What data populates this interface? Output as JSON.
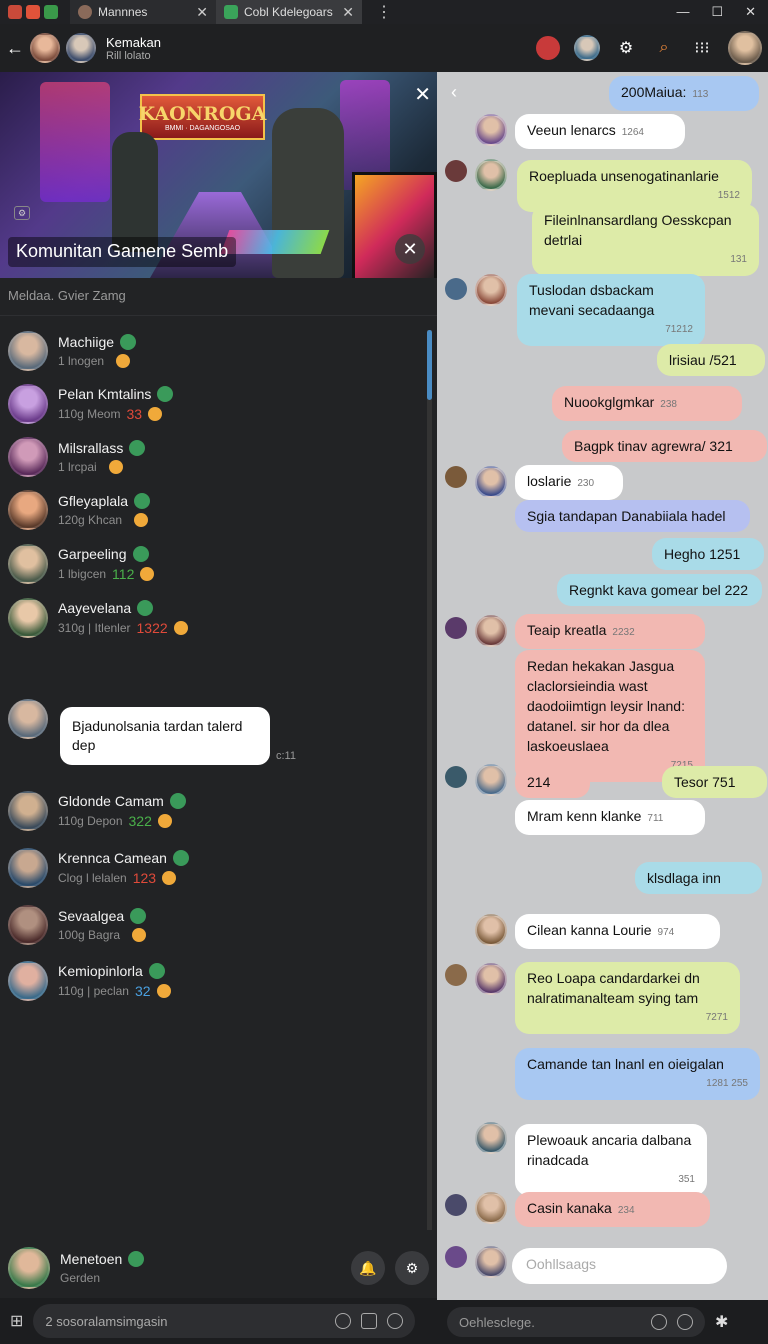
{
  "tabs": [
    {
      "label": "Mannnes"
    },
    {
      "label": "Cobl Kdelegoars"
    }
  ],
  "header": {
    "name": "Kemakan",
    "status": "Rill lolato"
  },
  "banner": {
    "logo": "KAONROGA",
    "logo_sub": "BMMI · DAGANGOSAO",
    "title": "Komunitan Gamene Semb"
  },
  "members_title": "Meldaa. Gvier Zamg",
  "members": [
    {
      "name": "Machiige",
      "sub": "1 lnogen",
      "count": ""
    },
    {
      "name": "Pelan Kmtalins",
      "sub": "110g Meom",
      "count": "33"
    },
    {
      "name": "Milsrallass",
      "sub": "1 lrcpai",
      "count": ""
    },
    {
      "name": "Gfleyaplala",
      "sub": "120g Khcan",
      "count": ""
    },
    {
      "name": "Garpeeling",
      "sub": "1 lbigcen",
      "count": "112"
    },
    {
      "name": "Aayevelana",
      "sub": "310g | Itlenler",
      "count": "1322"
    },
    {
      "name": "Gldonde Camam",
      "sub": "110g Depon",
      "count": "322"
    },
    {
      "name": "Krennca Camean",
      "sub": "Clog l lelalen",
      "count": "123"
    },
    {
      "name": "Sevaalgea",
      "sub": "100g Bagra",
      "count": ""
    },
    {
      "name": "Kemiopinlorla",
      "sub": "110g | peclan",
      "count": "32"
    }
  ],
  "popup": {
    "text": "Bjadunolsania tardan talerd dep",
    "time": "c:11"
  },
  "footer_member": {
    "name": "Menetoen",
    "sub": "Gerden"
  },
  "left_input": {
    "text": "2  sosoralamsimgasin"
  },
  "right_input": {
    "placeholder": "Oehlesclege."
  },
  "reply_input": {
    "placeholder": "Oohllsaags"
  },
  "messages": [
    {
      "text": "200Maiua:",
      "time": "113"
    },
    {
      "text": "Veeun lenarcs",
      "time": "1264"
    },
    {
      "text": "Roepluada unsenogatinanlarie",
      "time": "1512"
    },
    {
      "text": "Fileinlnansardlang Oesskcpan detrlai",
      "time": "131"
    },
    {
      "text": "Tuslodan dsbackam mevani secadaanga",
      "time": "71212"
    },
    {
      "text": "lrisiau /521",
      "time": ""
    },
    {
      "text": "Nuookglgmkar",
      "time": "238"
    },
    {
      "text": "Bagpk tinav agrewra/ 321",
      "time": ""
    },
    {
      "text": "loslarie",
      "time": "230"
    },
    {
      "text": "Sgia tandapan Danabiiala hadel",
      "time": ""
    },
    {
      "text": "Hegho 1251",
      "time": ""
    },
    {
      "text": "Regnkt kava gomear bel 222",
      "time": ""
    },
    {
      "text": "Teaip kreatla",
      "time": "2232"
    },
    {
      "text": "Redan hekakan Jasgua claclorsieindia wast daodoiimtign leysir lnand: datanel. sir hor da dlea laskoeuslaea",
      "time": "7215"
    },
    {
      "text": "214",
      "time": ""
    },
    {
      "text": "Tesor 751",
      "time": ""
    },
    {
      "text": "Mram kenn klanke",
      "time": "711"
    },
    {
      "text": "klsdlaga inn",
      "time": ""
    },
    {
      "text": "Cilean kanna Lourie",
      "time": "974"
    },
    {
      "text": "Reo Loapa candardarkei dn nalratimanalteam sying tam",
      "time": "7271"
    },
    {
      "text": "Camande tan lnanl en oieigalan",
      "time": "1281  255"
    },
    {
      "text": "Plewoauk ancaria dalbana rinadcada",
      "time": "351"
    },
    {
      "text": "Casin kanaka",
      "time": "234"
    }
  ]
}
